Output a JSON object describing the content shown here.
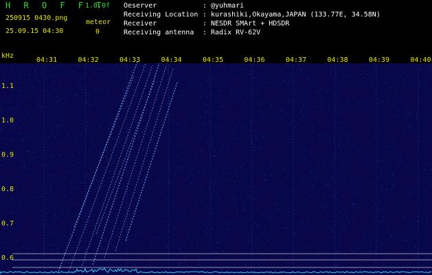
{
  "header": {
    "app_title": "H R O F F T",
    "version": "1.0.0f",
    "file_name": "250915 0430.png",
    "timestamp": "25.09.15 04:30",
    "meteor_label": "meteor",
    "meteor_count": "0"
  },
  "info": [
    {
      "key": "Oeserver",
      "value": "@yuhmari"
    },
    {
      "key": "Receiving Location",
      "value": "kurashiki,Okayama,JAPAN (133.77E, 34.58N)"
    },
    {
      "key": "Receiver",
      "value": "NESDR SMArt + HDSDR"
    },
    {
      "key": "Receiving antenna",
      "value": "Radix RV-62V"
    }
  ],
  "separator": ":",
  "axes": {
    "y_unit": "kHz",
    "y_labels": [
      "1.1",
      "1.0",
      "0.9",
      "0.8",
      "0.7",
      "0.6"
    ],
    "x_labels": [
      "04:31",
      "04:32",
      "04:33",
      "04:34",
      "04:35",
      "04:36",
      "04:37",
      "04:38",
      "04:39",
      "04:40"
    ]
  },
  "colors": {
    "background": "#07074a",
    "label": "#e6e600",
    "title": "#33dd33",
    "signal": "#7fb0ff",
    "baseline": "#33d0ff"
  }
}
